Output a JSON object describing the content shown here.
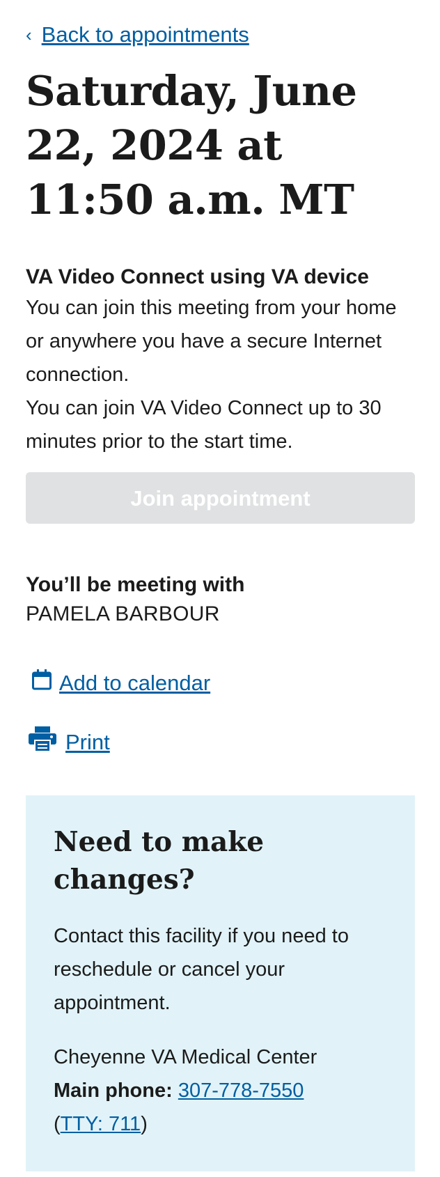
{
  "nav": {
    "back_label": "Back to appointments",
    "back_icon": "chevron-left-icon"
  },
  "appointment": {
    "heading": "Saturday, June 22, 2024 at 11:50 a.m. MT",
    "type_title": "VA Video Connect using VA device",
    "desc1": "You can join this meeting from your home or anywhere you have a secure Internet connection.",
    "desc2": "You can join VA Video Connect up to 30 minutes prior to the start time.",
    "join_label": "Join appointment",
    "meeting_label": "You’ll be meeting with",
    "provider": "PAMELA BARBOUR"
  },
  "actions": {
    "calendar_label": "Add to calendar",
    "calendar_icon": "calendar-icon",
    "print_label": "Print",
    "print_icon": "printer-icon"
  },
  "changes": {
    "title": "Need to make changes?",
    "body": "Contact this facility if you need to reschedule or cancel your appointment.",
    "facility": "Cheyenne VA Medical Center",
    "phone_label": "Main phone:",
    "phone": "307-778-7550",
    "tty": "TTY: 711"
  },
  "colors": {
    "link": "#005ea2",
    "text": "#1b1b1b",
    "button_disabled": "#dfe1e2",
    "callout_bg": "#e1f3f8"
  }
}
